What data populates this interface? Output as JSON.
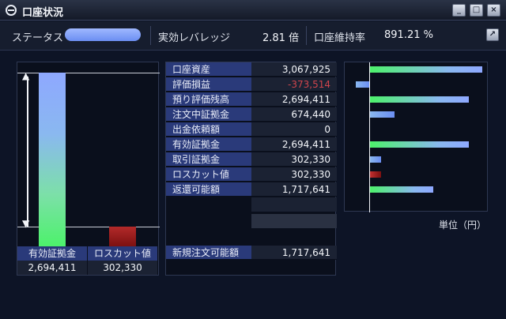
{
  "window": {
    "title": "口座状況",
    "buttons": [
      "_",
      "□",
      "×"
    ]
  },
  "status": {
    "status_label": "ステータス",
    "leverage_label": "実効レバレッジ",
    "leverage_value": "2.81 倍",
    "maintenance_label": "口座維持率",
    "maintenance_value": "891.21 %",
    "popout_icon": "popout-icon"
  },
  "left_chart": {
    "headers": [
      "有効証拠金",
      "ロスカット値"
    ],
    "values": [
      "2,694,411",
      "302,330"
    ]
  },
  "table": {
    "rows": [
      {
        "label": "口座資産",
        "value": "3,067,925"
      },
      {
        "label": "評価損益",
        "value": "-373,514"
      },
      {
        "label": "預り評価残高",
        "value": "2,694,411"
      },
      {
        "label": "注文中証拠金",
        "value": "674,440"
      },
      {
        "label": "出金依頼額",
        "value": "0"
      },
      {
        "label": "有効証拠金",
        "value": "2,694,411"
      },
      {
        "label": "取引証拠金",
        "value": "302,330"
      },
      {
        "label": "ロスカット値",
        "value": "302,330"
      },
      {
        "label": "返還可能額",
        "value": "1,717,641"
      }
    ],
    "new_order": {
      "label": "新規注文可能額",
      "value": "1,717,641"
    }
  },
  "right_chart": {
    "unit_label": "単位（円）",
    "max_value": 3067925,
    "bars": [
      {
        "value": 3067925,
        "color": "green"
      },
      {
        "value": -373514,
        "color": "blue"
      },
      {
        "value": 2694411,
        "color": "green"
      },
      {
        "value": 674440,
        "color": "blue"
      },
      {
        "value": 0,
        "color": "none"
      },
      {
        "value": 2694411,
        "color": "green"
      },
      {
        "value": 302330,
        "color": "blue"
      },
      {
        "value": 302330,
        "color": "red"
      },
      {
        "value": 1717641,
        "color": "green"
      }
    ]
  },
  "colors": {
    "green": "#4cf26a",
    "blue": "#8ea8ff",
    "red": "#b32a2a",
    "negative_text": "#d0454c"
  }
}
